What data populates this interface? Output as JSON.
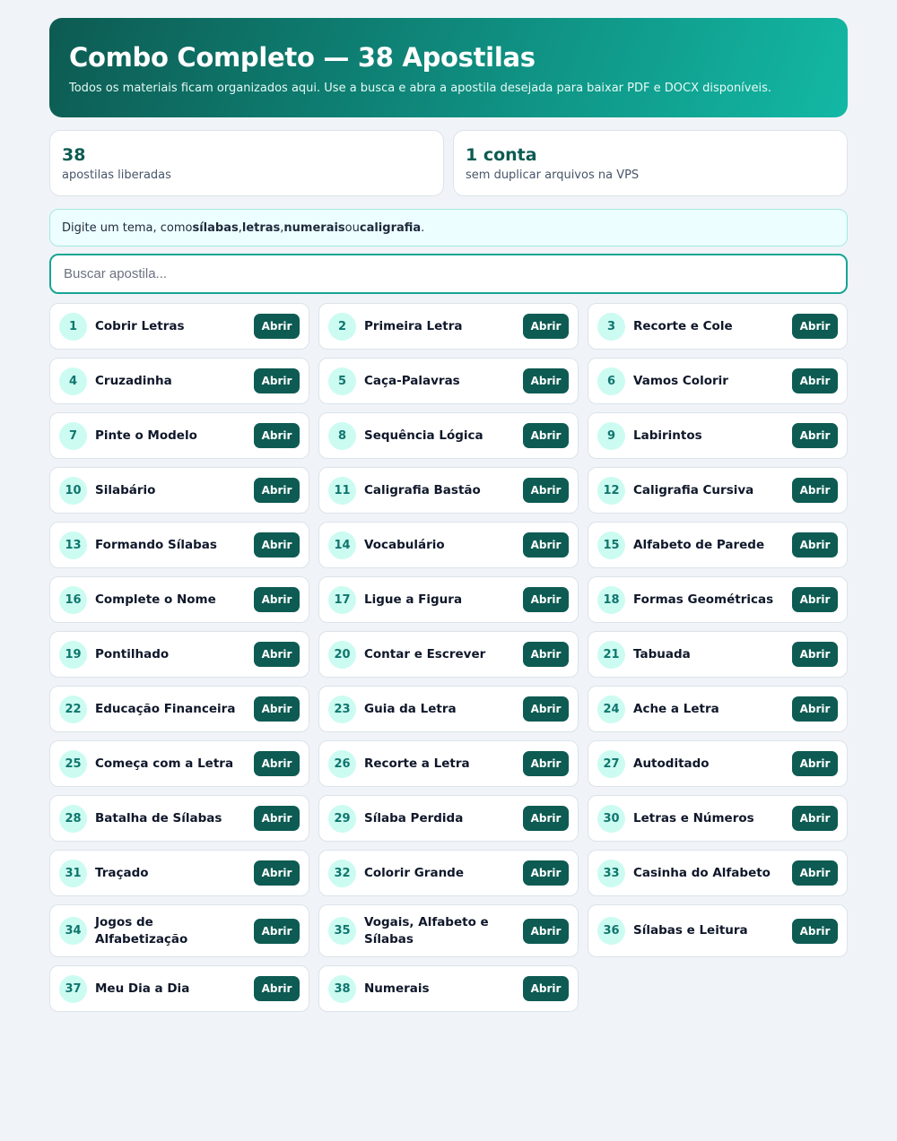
{
  "hero": {
    "title": "Combo Completo — 38 Apostilas",
    "subtitle": "Todos os materiais ficam organizados aqui. Use a busca e abra a apostila desejada para baixar PDF e DOCX disponíveis."
  },
  "stats": [
    {
      "value": "38",
      "label": "apostilas liberadas"
    },
    {
      "value": "1 conta",
      "label": "sem duplicar arquivos na VPS"
    }
  ],
  "hint": {
    "prefix": "Digite um tema, como ",
    "term1": "sílabas",
    "sep1": ", ",
    "term2": "letras",
    "sep2": ", ",
    "term3": "numerais",
    "sep3": " ou ",
    "term4": "caligrafia",
    "suffix": "."
  },
  "search": {
    "placeholder": "Buscar apostila...",
    "value": ""
  },
  "open_label": "Abrir",
  "items": [
    {
      "n": "1",
      "title": "Cobrir Letras"
    },
    {
      "n": "2",
      "title": "Primeira Letra"
    },
    {
      "n": "3",
      "title": "Recorte e Cole"
    },
    {
      "n": "4",
      "title": "Cruzadinha"
    },
    {
      "n": "5",
      "title": "Caça-Palavras"
    },
    {
      "n": "6",
      "title": "Vamos Colorir"
    },
    {
      "n": "7",
      "title": "Pinte o Modelo"
    },
    {
      "n": "8",
      "title": "Sequência Lógica"
    },
    {
      "n": "9",
      "title": "Labirintos"
    },
    {
      "n": "10",
      "title": "Silabário"
    },
    {
      "n": "11",
      "title": "Caligrafia Bastão"
    },
    {
      "n": "12",
      "title": "Caligrafia Cursiva"
    },
    {
      "n": "13",
      "title": "Formando Sílabas"
    },
    {
      "n": "14",
      "title": "Vocabulário"
    },
    {
      "n": "15",
      "title": "Alfabeto de Parede"
    },
    {
      "n": "16",
      "title": "Complete o Nome"
    },
    {
      "n": "17",
      "title": "Ligue a Figura"
    },
    {
      "n": "18",
      "title": "Formas Geométricas"
    },
    {
      "n": "19",
      "title": "Pontilhado"
    },
    {
      "n": "20",
      "title": "Contar e Escrever"
    },
    {
      "n": "21",
      "title": "Tabuada"
    },
    {
      "n": "22",
      "title": "Educação Financeira"
    },
    {
      "n": "23",
      "title": "Guia da Letra"
    },
    {
      "n": "24",
      "title": "Ache a Letra"
    },
    {
      "n": "25",
      "title": "Começa com a Letra"
    },
    {
      "n": "26",
      "title": "Recorte a Letra"
    },
    {
      "n": "27",
      "title": "Autoditado"
    },
    {
      "n": "28",
      "title": "Batalha de Sílabas"
    },
    {
      "n": "29",
      "title": "Sílaba Perdida"
    },
    {
      "n": "30",
      "title": "Letras e Números"
    },
    {
      "n": "31",
      "title": "Traçado"
    },
    {
      "n": "32",
      "title": "Colorir Grande"
    },
    {
      "n": "33",
      "title": "Casinha do Alfabeto"
    },
    {
      "n": "34",
      "title": "Jogos de Alfabetização"
    },
    {
      "n": "35",
      "title": "Vogais, Alfabeto e Sílabas"
    },
    {
      "n": "36",
      "title": "Sílabas e Leitura"
    },
    {
      "n": "37",
      "title": "Meu Dia a Dia"
    },
    {
      "n": "38",
      "title": "Numerais"
    }
  ]
}
